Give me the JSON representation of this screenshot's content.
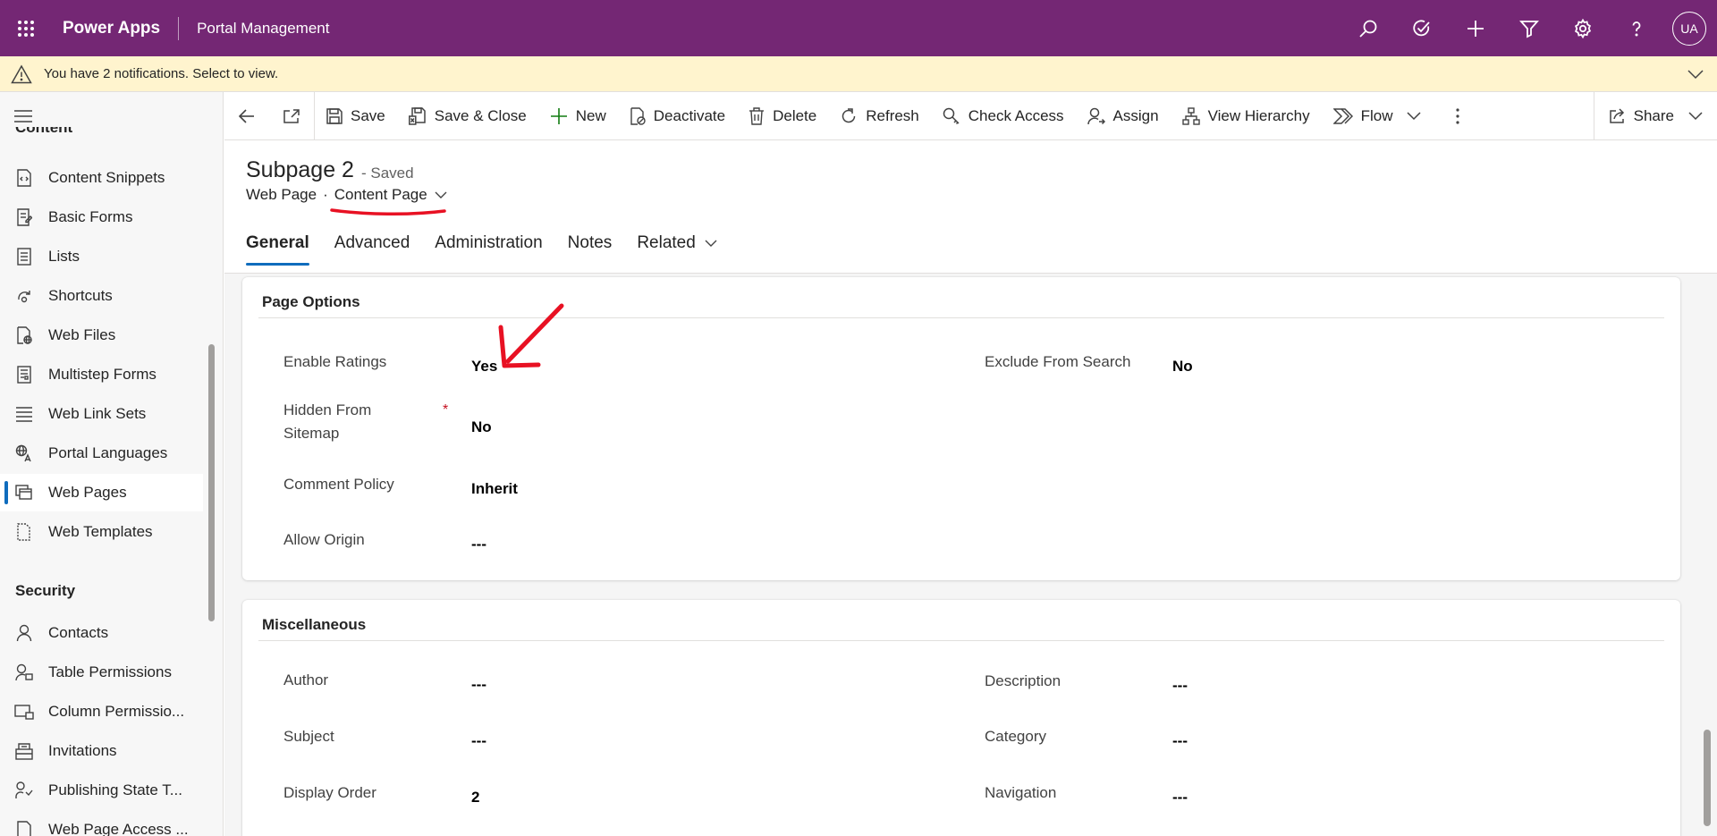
{
  "topbar": {
    "app_name": "Power Apps",
    "portal_name": "Portal Management",
    "avatar_initials": "UA",
    "icons": [
      "search-icon",
      "task-icon",
      "plus-icon",
      "filter-icon",
      "gear-icon",
      "help-icon"
    ]
  },
  "notification": {
    "text": "You have 2 notifications. Select to view."
  },
  "sidebar": {
    "cut_heading": "Content",
    "items": [
      {
        "label": "Content Snippets",
        "icon": "snippet-icon"
      },
      {
        "label": "Basic Forms",
        "icon": "form-icon"
      },
      {
        "label": "Lists",
        "icon": "list-icon"
      },
      {
        "label": "Shortcuts",
        "icon": "shortcut-icon"
      },
      {
        "label": "Web Files",
        "icon": "web-file-icon"
      },
      {
        "label": "Multistep Forms",
        "icon": "multistep-form-icon"
      },
      {
        "label": "Web Link Sets",
        "icon": "link-set-icon"
      },
      {
        "label": "Portal Languages",
        "icon": "language-icon"
      },
      {
        "label": "Web Pages",
        "icon": "web-pages-icon",
        "active": true
      },
      {
        "label": "Web Templates",
        "icon": "template-icon"
      }
    ],
    "security_heading": "Security",
    "security_items": [
      {
        "label": "Contacts",
        "icon": "contact-icon"
      },
      {
        "label": "Table Permissions",
        "icon": "table-permission-icon"
      },
      {
        "label": "Column Permissio...",
        "icon": "column-permission-icon"
      },
      {
        "label": "Invitations",
        "icon": "invitation-icon"
      },
      {
        "label": "Publishing State T...",
        "icon": "publishing-icon"
      },
      {
        "label": "Web Page Access ...",
        "icon": "access-icon"
      }
    ]
  },
  "commands": {
    "save": "Save",
    "save_close": "Save & Close",
    "new": "New",
    "deactivate": "Deactivate",
    "delete": "Delete",
    "refresh": "Refresh",
    "check_access": "Check Access",
    "assign": "Assign",
    "view_hierarchy": "View Hierarchy",
    "flow": "Flow",
    "share": "Share"
  },
  "record": {
    "title": "Subpage 2",
    "status": "- Saved",
    "entity": "Web Page",
    "separator": "·",
    "form": "Content Page"
  },
  "tabs": [
    "General",
    "Advanced",
    "Administration",
    "Notes",
    "Related"
  ],
  "sections": {
    "page_options": {
      "title": "Page Options",
      "fields": {
        "enable_ratings": {
          "label": "Enable Ratings",
          "value": "Yes"
        },
        "hidden_from_sitemap": {
          "label": "Hidden From Sitemap",
          "value": "No",
          "required_mark": "*"
        },
        "comment_policy": {
          "label": "Comment Policy",
          "value": "Inherit"
        },
        "allow_origin": {
          "label": "Allow Origin",
          "value": "---"
        },
        "exclude_from_search": {
          "label": "Exclude From Search",
          "value": "No"
        }
      }
    },
    "miscellaneous": {
      "title": "Miscellaneous",
      "fields": {
        "author": {
          "label": "Author",
          "value": "---"
        },
        "subject": {
          "label": "Subject",
          "value": "---"
        },
        "display_order": {
          "label": "Display Order",
          "value": "2"
        },
        "description": {
          "label": "Description",
          "value": "---"
        },
        "category": {
          "label": "Category",
          "value": "---"
        },
        "navigation": {
          "label": "Navigation",
          "value": "---"
        }
      }
    }
  },
  "colors": {
    "topbar": "#742774",
    "notification": "#fff4ce",
    "accent": "#0f6cbd",
    "annotation": "#e81123"
  }
}
